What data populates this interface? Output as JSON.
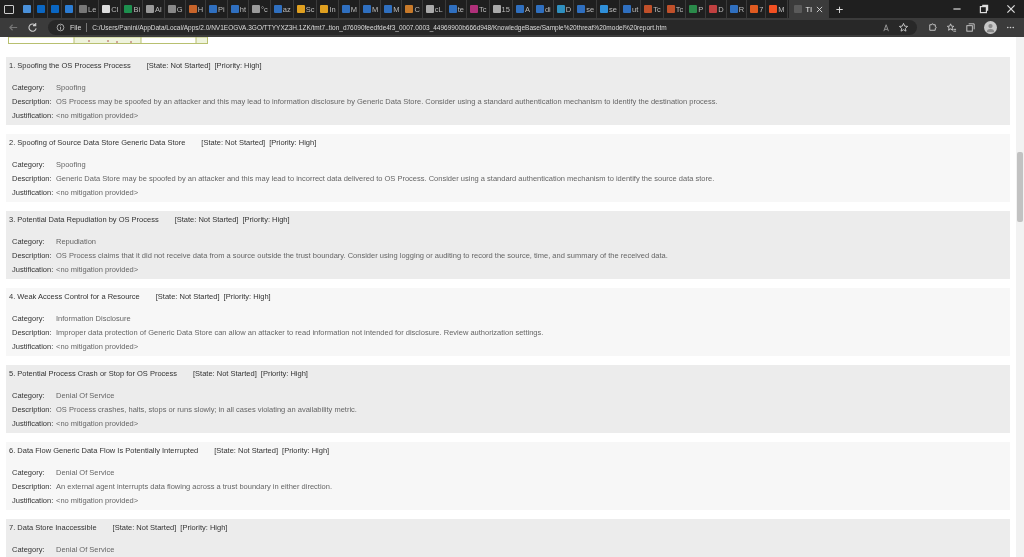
{
  "tabs": [
    {
      "color": "#4a90d9",
      "selected": false
    },
    {
      "color": "#0a66c2",
      "selected": false
    },
    {
      "color": "#0a66c2",
      "selected": false
    },
    {
      "color": "#2b7cd3",
      "selected": false
    },
    {
      "label": "Le",
      "color": "#777777",
      "selected": false
    },
    {
      "label": "Cl",
      "color": "#dddddd",
      "selected": false
    },
    {
      "label": "Bi",
      "color": "#1d8f4e",
      "selected": false
    },
    {
      "label": "Al",
      "color": "#999999",
      "selected": false
    },
    {
      "label": "G",
      "color": "#888888",
      "selected": false
    },
    {
      "label": "H",
      "color": "#c8642a",
      "selected": false
    },
    {
      "label": "Pi",
      "color": "#2f6fbf",
      "selected": false
    },
    {
      "label": "ht",
      "color": "#2f6fbf",
      "selected": false
    },
    {
      "label": "°c",
      "color": "#9a9a9a",
      "selected": false
    },
    {
      "label": "az",
      "color": "#2f6fbf",
      "selected": false
    },
    {
      "label": "Sc",
      "color": "#e0a020",
      "selected": false
    },
    {
      "label": "In",
      "color": "#e0a020",
      "selected": false
    },
    {
      "label": "M",
      "color": "#2f6fbf",
      "selected": false
    },
    {
      "label": "M",
      "color": "#2f6fbf",
      "selected": false
    },
    {
      "label": "M",
      "color": "#2f6fbf",
      "selected": false
    },
    {
      "label": "C",
      "color": "#c87a2a",
      "selected": false
    },
    {
      "label": "cL",
      "color": "#aaaaaa",
      "selected": false
    },
    {
      "label": "te",
      "color": "#2f6fbf",
      "selected": false
    },
    {
      "label": "Tc",
      "color": "#b0307a",
      "selected": false
    },
    {
      "label": "15",
      "color": "#aaaaaa",
      "selected": false
    },
    {
      "label": "A",
      "color": "#2f6fbf",
      "selected": false
    },
    {
      "label": "di",
      "color": "#2f6fbf",
      "selected": false
    },
    {
      "label": "D",
      "color": "#2f8fbf",
      "selected": false
    },
    {
      "label": "se",
      "color": "#2f6fbf",
      "selected": false
    },
    {
      "label": "se",
      "color": "#2f8fd9",
      "selected": false
    },
    {
      "label": "ut",
      "color": "#2f6fbf",
      "selected": false
    },
    {
      "label": "Tc",
      "color": "#c0502a",
      "selected": false
    },
    {
      "label": "Tc",
      "color": "#c0502a",
      "selected": false
    },
    {
      "label": "P",
      "color": "#2a8a4a",
      "selected": false
    },
    {
      "label": "D",
      "color": "#c04040",
      "selected": false
    },
    {
      "label": "R",
      "color": "#2f6fbf",
      "selected": false
    },
    {
      "label": "7",
      "color": "#e05a20",
      "selected": false
    },
    {
      "label": "M",
      "color": "#f25022",
      "selected": false
    },
    {
      "label": "Tl",
      "color": "#5a5a5a",
      "selected": true
    }
  ],
  "new_tab": "+",
  "address_bar": {
    "scheme": "File",
    "url": "C:/Users/Panini/AppData/Local/Apps/2.0/NV1EOGVA.3GO/TTYYXZ3H.1ZK/tmt7..tion_d76090feedfde4f3_0007.0003_44969900b666d948/KnowledgeBase/Sample%20threat%20model%20report.htm"
  },
  "threats": [
    {
      "title": "1. Spoofing the OS Process Process",
      "state": "[State: Not Started]",
      "priority": "[Priority: High]",
      "fields": [
        {
          "label": "Category:",
          "value": "Spoofing"
        },
        {
          "label": "Description:",
          "value": "OS Process may be spoofed by an attacker and this may lead to information disclosure by Generic Data Store. Consider using a standard authentication mechanism to identify the destination process."
        },
        {
          "label": "Justification:",
          "value": "<no mitigation provided>"
        }
      ]
    },
    {
      "title": "2. Spoofing of Source Data Store Generic Data Store",
      "state": "[State: Not Started]",
      "priority": "[Priority: High]",
      "fields": [
        {
          "label": "Category:",
          "value": "Spoofing"
        },
        {
          "label": "Description:",
          "value": "Generic Data Store may be spoofed by an attacker and this may lead to incorrect data delivered to OS Process. Consider using a standard authentication mechanism to identify the source data store."
        },
        {
          "label": "Justification:",
          "value": "<no mitigation provided>"
        }
      ]
    },
    {
      "title": "3. Potential Data Repudiation by OS Process",
      "state": "[State: Not Started]",
      "priority": "[Priority: High]",
      "fields": [
        {
          "label": "Category:",
          "value": "Repudiation"
        },
        {
          "label": "Description:",
          "value": "OS Process claims that it did not receive data from a source outside the trust boundary. Consider using logging or auditing to record the source, time, and summary of the received data."
        },
        {
          "label": "Justification:",
          "value": "<no mitigation provided>"
        }
      ]
    },
    {
      "title": "4. Weak Access Control for a Resource",
      "state": "[State: Not Started]",
      "priority": "[Priority: High]",
      "fields": [
        {
          "label": "Category:",
          "value": "Information Disclosure"
        },
        {
          "label": "Description:",
          "value": "Improper data protection of Generic Data Store can allow an attacker to read information not intended for disclosure. Review authorization settings."
        },
        {
          "label": "Justification:",
          "value": "<no mitigation provided>"
        }
      ]
    },
    {
      "title": "5. Potential Process Crash or Stop for OS Process",
      "state": "[State: Not Started]",
      "priority": "[Priority: High]",
      "fields": [
        {
          "label": "Category:",
          "value": "Denial Of Service"
        },
        {
          "label": "Description:",
          "value": "OS Process crashes, halts, stops or runs slowly; in all cases violating an availability metric."
        },
        {
          "label": "Justification:",
          "value": "<no mitigation provided>"
        }
      ]
    },
    {
      "title": "6. Data Flow Generic Data Flow Is Potentially Interrupted",
      "state": "[State: Not Started]",
      "priority": "[Priority: High]",
      "fields": [
        {
          "label": "Category:",
          "value": "Denial Of Service"
        },
        {
          "label": "Description:",
          "value": "An external agent interrupts data flowing across a trust boundary in either direction."
        },
        {
          "label": "Justification:",
          "value": "<no mitigation provided>"
        }
      ]
    },
    {
      "title": "7. Data Store Inaccessible",
      "state": "[State: Not Started]",
      "priority": "[Priority: High]",
      "fields": [
        {
          "label": "Category:",
          "value": "Denial Of Service"
        }
      ]
    }
  ]
}
